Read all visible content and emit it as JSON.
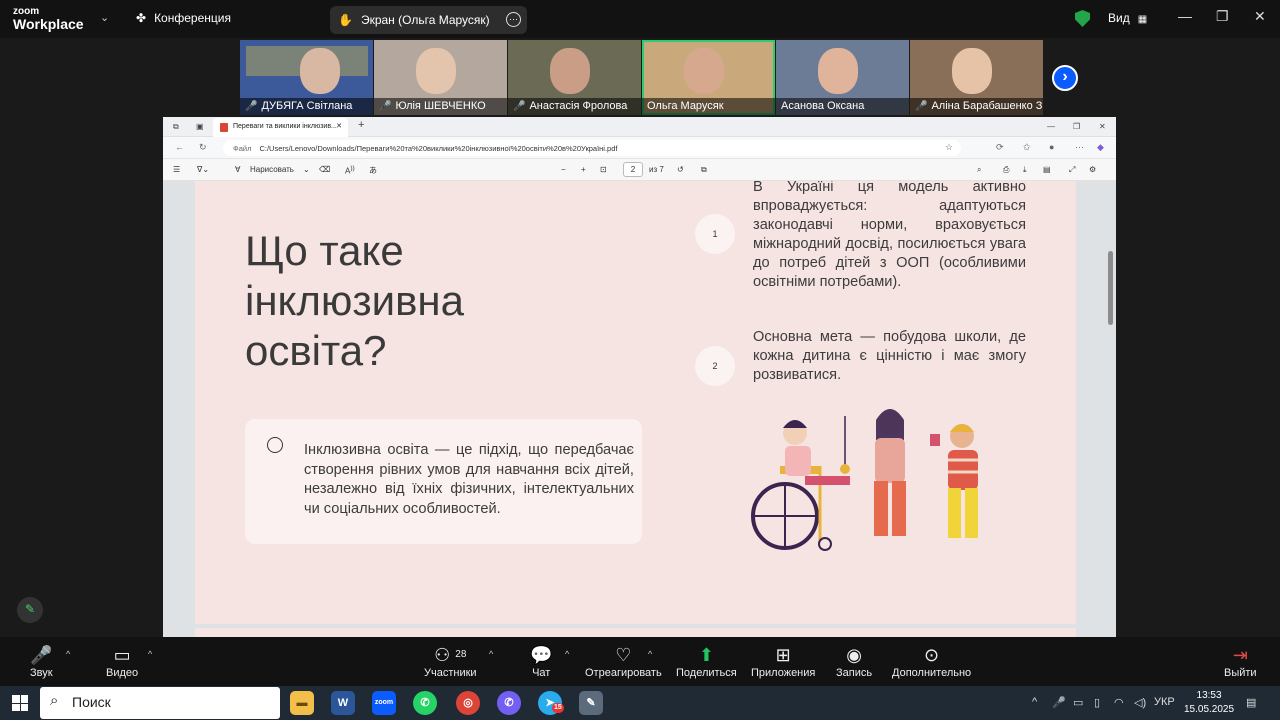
{
  "zoom_header": {
    "logo_line1": "zoom",
    "logo_line2": "Workplace",
    "meeting_label": "Конференция",
    "screen_share_label": "Экран (Ольга Марусяк)",
    "view_label": "Вид"
  },
  "participants": [
    {
      "name": "ДУБЯГА Світлана",
      "muted": true,
      "bg": "#3c5a9a",
      "face": "#d9b8a3"
    },
    {
      "name": "Юлія ШЕВЧЕНКО",
      "muted": true,
      "bg": "#b4a79d",
      "face": "#e3c4ac"
    },
    {
      "name": "Анастасія Фролова",
      "muted": true,
      "bg": "#6a6a55",
      "face": "#c99d86"
    },
    {
      "name": "Ольга Марусяк",
      "muted": false,
      "bg": "#c9a87c",
      "face": "#d6a98f"
    },
    {
      "name": "Асанова Оксана",
      "muted": false,
      "bg": "#6d7c96",
      "face": "#e0b49a"
    },
    {
      "name": "Аліна Барабашенко З ...",
      "muted": true,
      "bg": "#8a6f58",
      "face": "#e6c2a6"
    }
  ],
  "browser": {
    "tab_title": "Переваги та виклики інклюзив...",
    "address_prefix": "Файл",
    "address_url": "C:/Users/Lenovo/Downloads/Переваги%20та%20виклики%20інклюзивної%20освіти%20в%20Україні.pdf",
    "draw_label": "Нарисовать",
    "page_current": "2",
    "page_total": "из 7"
  },
  "slide": {
    "heading": "Що таке інклюзивна освіта?",
    "callout_text": "Інклюзивна освіта — це підхід, що передбачає створення рівних умов для навчання всіх дітей, незалежно від їхніх фізичних, інтелектуальних чи соціальних особливостей.",
    "point1_num": "1",
    "point1_text": "В Україні ця модель активно впроваджується: адаптуються законодавчі норми, враховується міжнародний досвід, посилюється увага до потреб дітей з ООП (особливими освітніми потребами).",
    "point2_num": "2",
    "point2_text": "Основна мета — побудова школи, де кожна дитина є цінністю і має змогу розвиватися."
  },
  "zoom_toolbar": {
    "audio": "Звук",
    "video": "Видео",
    "participants": "Участники",
    "participants_count": "28",
    "chat": "Чат",
    "react": "Отреагировать",
    "share": "Поделиться",
    "apps": "Приложения",
    "record": "Запись",
    "more": "Дополнительно",
    "leave": "Выйти"
  },
  "taskbar": {
    "search_placeholder": "Поиск",
    "language": "УКР",
    "time": "13:53",
    "date": "15.05.2025",
    "telegram_badge": "15"
  }
}
